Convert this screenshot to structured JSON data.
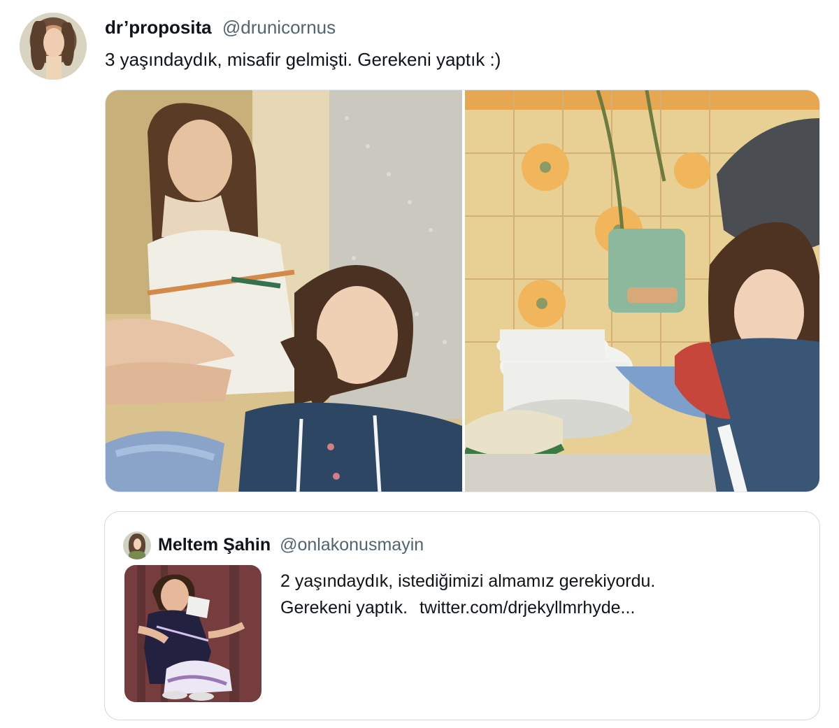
{
  "tweet": {
    "author": {
      "display_name": "dr’proposita",
      "handle": "@drunicornus"
    },
    "text": "3 yaşındaydık, misafir gelmişti. Gerekeni yaptık :)"
  },
  "quoted_tweet": {
    "author": {
      "display_name": "Meltem Şahin",
      "handle": "@onlakonusmayin"
    },
    "text_line_1": "2 yaşındaydık, istediğimizi almamız gerekiyordu.",
    "text_line_2": "Gerekeni yaptık.",
    "link": "twitter.com/drjekyllmrhyde..."
  },
  "icons": {
    "author_avatar": "profile-photo",
    "quoted_avatar": "profile-photo"
  }
}
